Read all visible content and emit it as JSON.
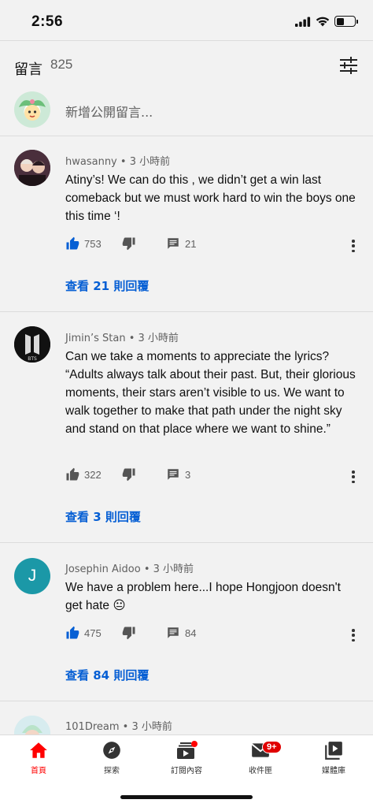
{
  "status_bar": {
    "time": "2:56"
  },
  "header": {
    "title": "留言",
    "count": "825"
  },
  "add_comment": {
    "placeholder": "新增公開留言..."
  },
  "comments": [
    {
      "author": "hwasanny",
      "time": "• 3 小時前",
      "text": "Atiny’s! We can do this , we didn’t get a win last comeback but we must work hard to win the boys one this time ‘!",
      "likes": "753",
      "liked": true,
      "replies": "21",
      "view_replies": "查看 21 則回覆"
    },
    {
      "author": "Jimin’s Stan",
      "time": "• 3 小時前",
      "text": "Can we take a moments to appreciate the lyrics? “Adults always talk about their past. But, their glorious moments, their stars aren’t visible to us. We want to walk together to make that path under the night sky and stand on that place where we want to shine.”",
      "likes": "322",
      "liked": false,
      "replies": "3",
      "view_replies": "查看 3 則回覆",
      "avatar_text": "BTS"
    },
    {
      "author": "Josephin Aidoo",
      "time": "• 3 小時前",
      "text": "We have a problem here...I hope Hongjoon doesn't get hate 😐",
      "likes": "475",
      "liked": true,
      "replies": "84",
      "view_replies": "查看 84 則回覆",
      "avatar_letter": "J"
    },
    {
      "author": "101Dream",
      "time": "• 3 小時前"
    }
  ],
  "bottom_nav": {
    "items": [
      {
        "label": "首頁",
        "icon": "home-icon",
        "active": true
      },
      {
        "label": "探索",
        "icon": "explore-icon"
      },
      {
        "label": "訂閱內容",
        "icon": "subscriptions-icon"
      },
      {
        "label": "收件匣",
        "icon": "inbox-icon",
        "badge": "9+"
      },
      {
        "label": "媒體庫",
        "icon": "library-icon"
      }
    ]
  },
  "colors": {
    "accent_blue": "#065fd4",
    "brand_red": "#ff0000",
    "background": "#f2f2f2",
    "avatar_j": "#1b98a7"
  }
}
